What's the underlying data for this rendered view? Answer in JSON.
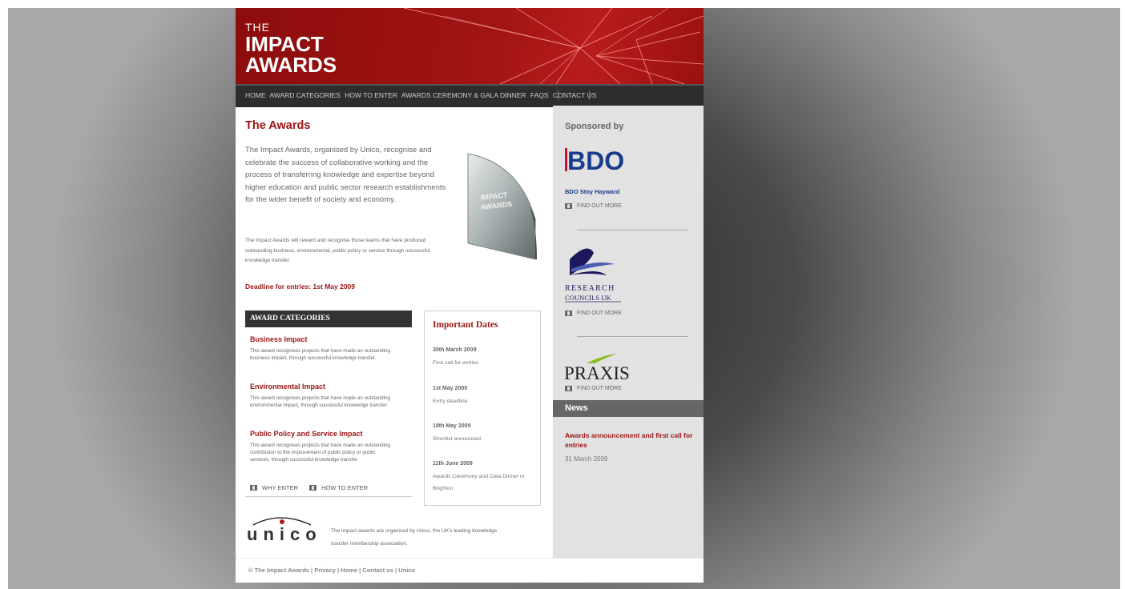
{
  "header": {
    "logo_line1": "THE",
    "logo_line2": "IMPACT",
    "logo_line3": "AWARDS"
  },
  "nav": {
    "items": [
      "HOME",
      "AWARD CATEGORIES",
      "HOW TO ENTER",
      "AWARDS CEREMONY & GALA DINNER",
      "FAQS",
      "CONTACT US"
    ]
  },
  "main": {
    "heading": "The Awards",
    "intro": "The Impact Awards, organised by Unico, recognise and celebrate the success of collaborative working and the process of transferring knowledge and expertise beyond higher education and public sector research establishments for the wider benefit of society and economy.",
    "small_text": "The Impact Awards will reward and recognise those teams that have produced outstanding business, environmental, public policy or service through successful knowledge transfer.",
    "deadline": "Deadline for entries: 1st May 2009"
  },
  "categories": {
    "heading": "AWARD CATEGORIES",
    "items": [
      {
        "title": "Business Impact",
        "desc": "This award recognises projects that have made an outstanding business impact, through successful knowledge transfer."
      },
      {
        "title": "Environmental Impact",
        "desc": "This award recognises projects that have made an outstanding environmental impact, through successful knowledge transfer."
      },
      {
        "title": "Public Policy and Service Impact",
        "desc": "This award recognises projects that have made an outstanding contribution to the improvement of public policy or public services, through successful knowledge transfer."
      }
    ],
    "why_enter": "WHY ENTER",
    "how_to_enter": "HOW TO ENTER"
  },
  "dates": {
    "heading": "Important Dates",
    "items": [
      {
        "date": "30th March 2009",
        "desc": "First call for entries"
      },
      {
        "date": "1st May 2009",
        "desc": "Entry deadline"
      },
      {
        "date": "18th May 2009",
        "desc": "Shortlist announced"
      },
      {
        "date": "11th June 2009",
        "desc": "Awards Ceremony and Gala Dinner in Brighton"
      }
    ]
  },
  "unico": {
    "logo": "unico",
    "text": "The impact awards are organised by Unico, the UK's leading knowledge transfer membership association."
  },
  "sidebar": {
    "title": "Sponsored by",
    "bdo_logo": "BDO",
    "bdo_name": "BDO Stoy Hayward",
    "rcuk_line1": "RESEARCH",
    "rcuk_line2": "COUNCILS UK",
    "praxis_logo": "PRAXIS",
    "find_out_more": "FIND OUT MORE",
    "news_heading": "News",
    "news_title": "Awards announcement and first call for entries",
    "news_date": "31 March 2009"
  },
  "footer": {
    "text": "© The Impact Awards  | Privacy | Home | Contact us | Unico"
  },
  "colors": {
    "brand_red": "#9b1414",
    "nav_bg": "#2d2d2d",
    "sidebar_bg": "#e2e2e2"
  }
}
